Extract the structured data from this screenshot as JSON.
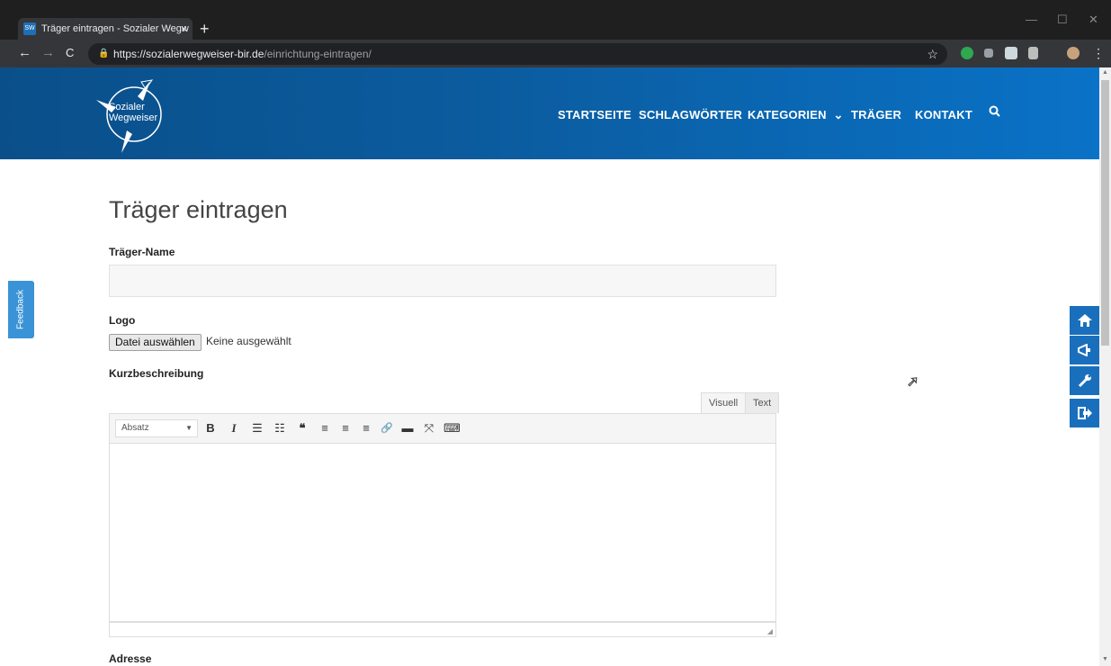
{
  "browser": {
    "tab_title": "Träger eintragen - Sozialer Wegw",
    "tab_favicon": "SW",
    "tab_close": "×",
    "new_tab": "+",
    "win_min": "—",
    "win_max": "☐",
    "win_close": "✕",
    "url_host": "https://sozialerwegweiser-bir.de",
    "url_path": "/einrichtung-eintragen/",
    "back": "←",
    "forward": "→",
    "reload": "C",
    "star": "☆",
    "menu": "⋮"
  },
  "site": {
    "logo_line1": "Sozialer",
    "logo_line2": "Wegweiser",
    "nav": [
      "STARTSEITE",
      "SCHLAGWÖRTER",
      "KATEGORIEN",
      "TRÄGER",
      "KONTAKT"
    ],
    "kategorien_chevron": "⌄",
    "search_icon_glyph": "⚲"
  },
  "form": {
    "title": "Träger eintragen",
    "name_label": "Träger-Name",
    "name_value": "",
    "logo_label": "Logo",
    "file_button": "Datei auswählen",
    "file_status": "Keine ausgewählt",
    "desc_label": "Kurzbeschreibung",
    "tab_visual": "Visuell",
    "tab_text": "Text",
    "format_select": "Absatz",
    "format_arrow": "▼",
    "toolbar": [
      "B",
      "I",
      "☰",
      "☷",
      "❝",
      "≡",
      "≡",
      "≡",
      "🔗",
      "▬",
      "⤧",
      "⌨"
    ],
    "resize": "◢",
    "address_label": "Adresse"
  },
  "feedback_label": "Feedback",
  "side_buttons": [
    "⌂",
    "📢",
    "🔧",
    "➜"
  ],
  "scroll": {
    "up": "▲",
    "down": "▼"
  },
  "cursor": "➚"
}
